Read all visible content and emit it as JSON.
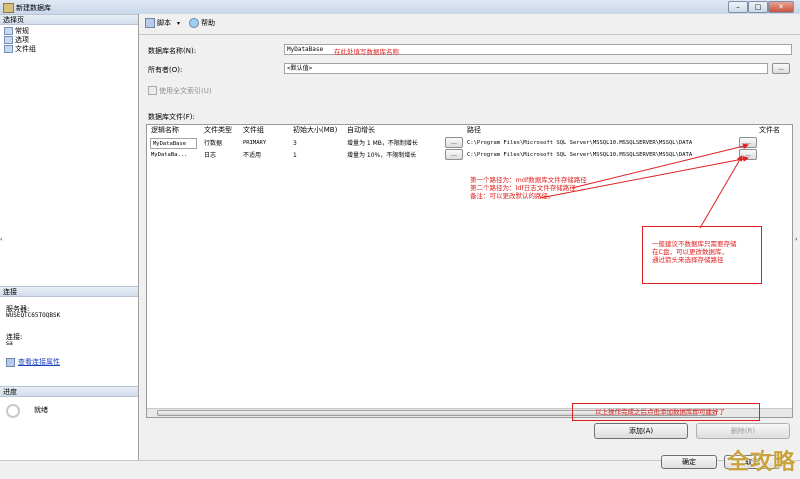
{
  "window": {
    "title": "新建数据库"
  },
  "left": {
    "select_page_header": "选择页",
    "pages": [
      "常规",
      "选项",
      "文件组"
    ],
    "connection_header": "连接",
    "server_label": "服务器:",
    "server_value": "WUSEQTC65TOQBSK",
    "connection_label": "连接:",
    "connection_value": "sa",
    "view_conn_props": "查看连接属性",
    "progress_header": "进度",
    "progress_status": "就绪"
  },
  "toolbar": {
    "script": "脚本",
    "help": "帮助"
  },
  "form": {
    "db_name_label": "数据库名称(N):",
    "db_name_value": "MyDataBase",
    "owner_label": "所有者(O):",
    "owner_value": "<默认值>",
    "fulltext_label": "使用全文索引(U)",
    "files_label": "数据库文件(F):"
  },
  "grid": {
    "columns": [
      "逻辑名称",
      "文件类型",
      "文件组",
      "初始大小(MB)",
      "自动增长",
      "路径",
      "文件名"
    ],
    "rows": [
      {
        "logical": "MyDataBase",
        "type": "行数据",
        "group": "PRIMARY",
        "size": "3",
        "growth": "增量为 1 MB，不限制增长",
        "path": "C:\\Program Files\\Microsoft SQL Server\\MSSQL10.MSSQLSERVER\\MSSQL\\DATA"
      },
      {
        "logical": "MyDataBa...",
        "type": "日志",
        "group": "不适用",
        "size": "1",
        "growth": "增量为 10%，不限制增长",
        "path": "C:\\Program Files\\Microsoft SQL Server\\MSSQL10.MSSQLSERVER\\MSSQL\\DATA"
      }
    ],
    "ellipsis": "..."
  },
  "buttons": {
    "add": "添加(A)",
    "remove": "删除(R)",
    "ok": "确定",
    "cancel": "取消"
  },
  "annotations": {
    "name_hint": "在此处填写数据库名称",
    "path_hints": [
      "第一个路径为：mdf数据库文件存储路径",
      "第二个路径为：ldf日志文件存储路径",
      "备注：可以更改默认的路径。"
    ],
    "path_tip": [
      "一般建议不数据库只需要存储",
      "在C盘，可以更改数据库，",
      "通过箭头来选择存储路径"
    ],
    "bottom_hint": "以上操作完成之后点击添加数据库即可建好了"
  },
  "watermark": "全攻略",
  "colors": {
    "annotation": "#e02020",
    "link": "#1a3fbf",
    "watermark": "#caa23c"
  }
}
